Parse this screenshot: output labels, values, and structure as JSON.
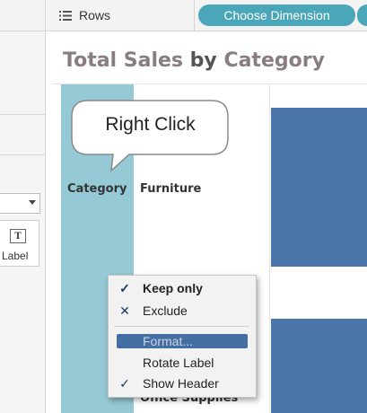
{
  "toolbar": {
    "rows_label": "Rows",
    "rows_icon": "rows-lines-icon",
    "pill_label": "Choose Dimension",
    "pill_color": "#4aa7b9"
  },
  "left_panel": {
    "label_card_icon": "text-label-icon",
    "label_card_icon_glyph": "T",
    "label_card_text": "Label"
  },
  "title": {
    "part1": "Total Sales",
    "part2": " by ",
    "part3": "Category"
  },
  "view": {
    "category_header": "Category",
    "row1_label": "Furniture",
    "row3_label": "Office Supplies",
    "band_color": "#96c9d6",
    "bar_color": "#4a74aa"
  },
  "callout": {
    "text": "Right Click"
  },
  "context_menu": {
    "items": [
      {
        "label": "Keep only",
        "mark": "✓",
        "icon": "check-icon"
      },
      {
        "label": "Exclude",
        "mark": "✕",
        "icon": "x-icon"
      },
      {
        "label": "Format...",
        "mark": "",
        "icon": ""
      },
      {
        "label": "Rotate Label",
        "mark": "",
        "icon": ""
      },
      {
        "label": "Show Header",
        "mark": "✓",
        "icon": "check-icon"
      }
    ],
    "highlight_color": "#456ea3"
  }
}
